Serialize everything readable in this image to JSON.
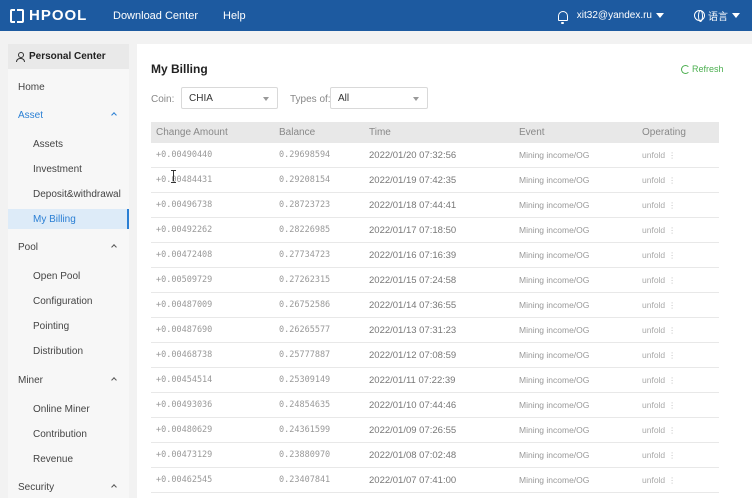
{
  "topbar": {
    "logo_text": "HPOOL",
    "nav": [
      "Download Center",
      "Help"
    ],
    "user_email": "xit32@yandex.ru",
    "language": "语言"
  },
  "sidebar": {
    "header": "Personal Center",
    "items": [
      {
        "label": "Home"
      },
      {
        "label": "Asset"
      },
      {
        "label": "Assets"
      },
      {
        "label": "Investment"
      },
      {
        "label": "Deposit&withdrawal"
      },
      {
        "label": "My Billing"
      },
      {
        "label": "Pool"
      },
      {
        "label": "Open Pool"
      },
      {
        "label": "Configuration"
      },
      {
        "label": "Pointing"
      },
      {
        "label": "Distribution"
      },
      {
        "label": "Miner"
      },
      {
        "label": "Online Miner"
      },
      {
        "label": "Contribution"
      },
      {
        "label": "Revenue"
      },
      {
        "label": "Security"
      }
    ]
  },
  "main": {
    "title": "My Billing",
    "refresh_label": "Refresh",
    "filters": {
      "coin_label": "Coin:",
      "coin_value": "CHIA",
      "type_label": "Types of:",
      "type_value": "All"
    },
    "table": {
      "columns": [
        "Change Amount",
        "Balance",
        "Time",
        "Event",
        "Operating"
      ],
      "rows": [
        {
          "amount": "+0.00490440",
          "balance": "0.29698594",
          "time": "2022/01/20 07:32:56",
          "event": "Mining income/OG",
          "op": "unfold"
        },
        {
          "amount": "+0.00484431",
          "balance": "0.29208154",
          "time": "2022/01/19 07:42:35",
          "event": "Mining income/OG",
          "op": "unfold"
        },
        {
          "amount": "+0.00496738",
          "balance": "0.28723723",
          "time": "2022/01/18 07:44:41",
          "event": "Mining income/OG",
          "op": "unfold"
        },
        {
          "amount": "+0.00492262",
          "balance": "0.28226985",
          "time": "2022/01/17 07:18:50",
          "event": "Mining income/OG",
          "op": "unfold"
        },
        {
          "amount": "+0.00472408",
          "balance": "0.27734723",
          "time": "2022/01/16 07:16:39",
          "event": "Mining income/OG",
          "op": "unfold"
        },
        {
          "amount": "+0.00509729",
          "balance": "0.27262315",
          "time": "2022/01/15 07:24:58",
          "event": "Mining income/OG",
          "op": "unfold"
        },
        {
          "amount": "+0.00487009",
          "balance": "0.26752586",
          "time": "2022/01/14 07:36:55",
          "event": "Mining income/OG",
          "op": "unfold"
        },
        {
          "amount": "+0.00487690",
          "balance": "0.26265577",
          "time": "2022/01/13 07:31:23",
          "event": "Mining income/OG",
          "op": "unfold"
        },
        {
          "amount": "+0.00468738",
          "balance": "0.25777887",
          "time": "2022/01/12 07:08:59",
          "event": "Mining income/OG",
          "op": "unfold"
        },
        {
          "amount": "+0.00454514",
          "balance": "0.25309149",
          "time": "2022/01/11 07:22:39",
          "event": "Mining income/OG",
          "op": "unfold"
        },
        {
          "amount": "+0.00493036",
          "balance": "0.24854635",
          "time": "2022/01/10 07:44:46",
          "event": "Mining income/OG",
          "op": "unfold"
        },
        {
          "amount": "+0.00480629",
          "balance": "0.24361599",
          "time": "2022/01/09 07:26:55",
          "event": "Mining income/OG",
          "op": "unfold"
        },
        {
          "amount": "+0.00473129",
          "balance": "0.23880970",
          "time": "2022/01/08 07:02:48",
          "event": "Mining income/OG",
          "op": "unfold"
        },
        {
          "amount": "+0.00462545",
          "balance": "0.23407841",
          "time": "2022/01/07 07:41:00",
          "event": "Mining income/OG",
          "op": "unfold"
        }
      ]
    }
  },
  "colors": {
    "topbar": "#1d5aa0",
    "accent": "#2a7fd4",
    "refresh": "#4caf50"
  }
}
